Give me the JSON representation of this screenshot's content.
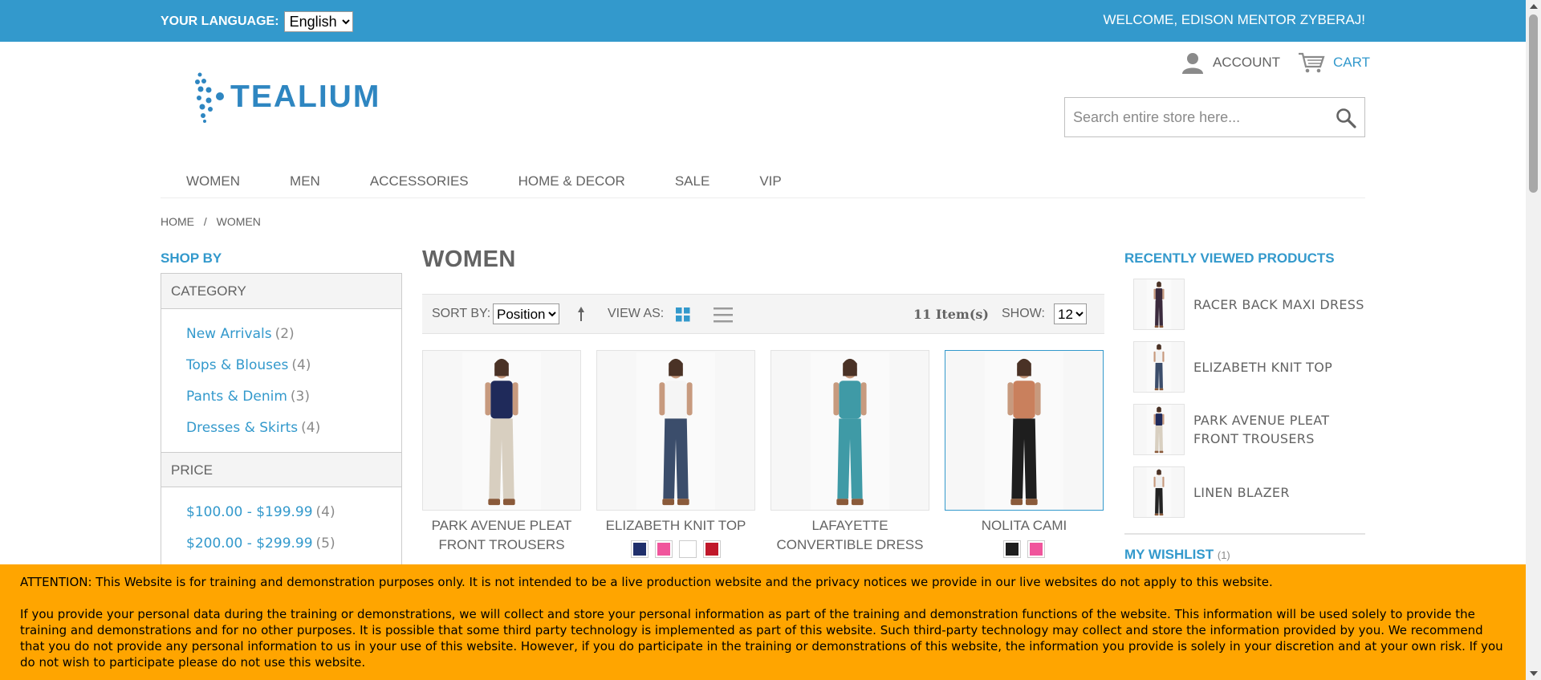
{
  "topbar": {
    "language_label": "YOUR LANGUAGE:",
    "language_value": "English",
    "welcome": "WELCOME, EDISON MENTOR ZYBERAJ!"
  },
  "header": {
    "logo_text": "TEALIUM",
    "account_label": "ACCOUNT",
    "cart_label": "CART",
    "search_placeholder": "Search entire store here..."
  },
  "nav": [
    "WOMEN",
    "MEN",
    "ACCESSORIES",
    "HOME & DECOR",
    "SALE",
    "VIP"
  ],
  "breadcrumb": {
    "home": "HOME",
    "separator": "/",
    "current": "WOMEN"
  },
  "sidebar": {
    "shop_by": "SHOP BY",
    "category_title": "CATEGORY",
    "categories": [
      {
        "label": "New Arrivals",
        "count": "(2)"
      },
      {
        "label": "Tops & Blouses",
        "count": "(4)"
      },
      {
        "label": "Pants & Denim",
        "count": "(3)"
      },
      {
        "label": "Dresses & Skirts",
        "count": "(4)"
      }
    ],
    "price_title": "PRICE",
    "prices": [
      {
        "label": "$100.00 - $199.99",
        "count": "(4)"
      },
      {
        "label": "$200.00 - $299.99",
        "count": "(5)"
      }
    ]
  },
  "main": {
    "title": "WOMEN",
    "toolbar": {
      "sort_label": "SORT BY:",
      "sort_value": "Position",
      "view_label": "VIEW AS:",
      "items_count": "11 Item(s)",
      "show_label": "SHOW:",
      "show_value": "12"
    },
    "products": [
      {
        "name": "PARK AVENUE PLEAT FRONT TROUSERS",
        "top": "#1f2a5a",
        "bottom": "#d8cfc0",
        "swatches": []
      },
      {
        "name": "ELIZABETH KNIT TOP",
        "top": "#f5f5f5",
        "bottom": "#3b4d6b",
        "swatches": [
          "#1f2f6b",
          "#f0559c",
          "#ffffff",
          "#c0182a"
        ]
      },
      {
        "name": "LAFAYETTE CONVERTIBLE DRESS",
        "top": "#3f9aa6",
        "bottom": "#3f9aa6",
        "swatches": []
      },
      {
        "name": "NOLITA CAMI",
        "top": "#c9805d",
        "bottom": "#1e1e1e",
        "swatches": [
          "#1e1e1e",
          "#f0559c"
        ]
      }
    ]
  },
  "recently_viewed": {
    "title": "RECENTLY VIEWED PRODUCTS",
    "items": [
      {
        "name": "RACER BACK MAXI DRESS",
        "top": "#3a2a3c",
        "bottom": "#3a2a3c"
      },
      {
        "name": "ELIZABETH KNIT TOP",
        "top": "#f2f2f2",
        "bottom": "#3b4d6b"
      },
      {
        "name": "PARK AVENUE PLEAT FRONT TROUSERS",
        "top": "#1f2a5a",
        "bottom": "#d8cfc0"
      },
      {
        "name": "LINEN BLAZER",
        "top": "#eeeeee",
        "bottom": "#222222"
      }
    ]
  },
  "wishlist": {
    "title": "MY WISHLIST",
    "count": "(1)"
  },
  "notice": {
    "p1": "ATTENTION: This Website is for training and demonstration purposes only. It is not intended to be a live production website and the privacy notices we provide in our live websites do not apply to this website.",
    "p2": "If you provide your personal data during the training or demonstrations, we will collect and store your personal information as part of the training and demonstration functions of the website. This information will be used solely to provide the training and demonstrations and for no other purposes. It is possible that some third party technology is implemented as part of this website. Such third-party technology may collect and store the information provided by you. We recommend that you do not provide any personal information to us in your use of this website. However, if you do participate in the training or demonstrations of this website, the information you provide is solely in your discretion and at your own risk. If you do not wish to participate please do not use this website."
  },
  "colors": {
    "accent": "#3399cc",
    "notice_bg": "#ffa500",
    "text": "#636363"
  }
}
